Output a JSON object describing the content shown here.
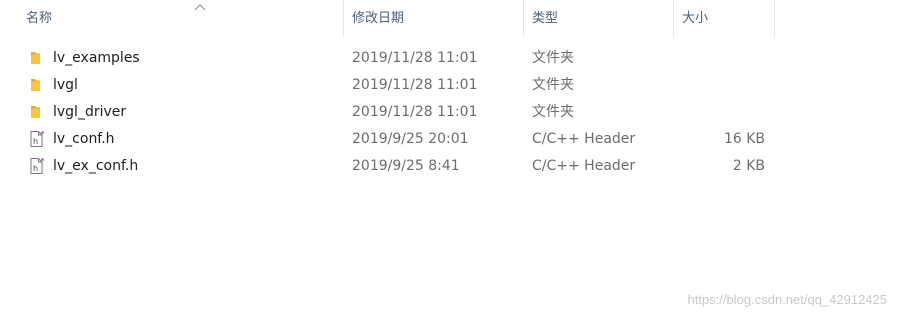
{
  "columns": {
    "name": "名称",
    "date": "修改日期",
    "type": "类型",
    "size": "大小"
  },
  "files": [
    {
      "name": "lv_examples",
      "date": "2019/11/28 11:01",
      "type": "文件夹",
      "size": "",
      "icon": "folder-icon"
    },
    {
      "name": "lvgl",
      "date": "2019/11/28 11:01",
      "type": "文件夹",
      "size": "",
      "icon": "folder-icon"
    },
    {
      "name": "lvgl_driver",
      "date": "2019/11/28 11:01",
      "type": "文件夹",
      "size": "",
      "icon": "folder-icon"
    },
    {
      "name": "lv_conf.h",
      "date": "2019/9/25 20:01",
      "type": "C/C++ Header",
      "size": "16 KB",
      "icon": "header-file-icon"
    },
    {
      "name": "lv_ex_conf.h",
      "date": "2019/9/25 8:41",
      "type": "C/C++ Header",
      "size": "2 KB",
      "icon": "header-file-icon"
    }
  ],
  "watermark": "https://blog.csdn.net/qq_42912425",
  "colors": {
    "folder": "#f8c541",
    "header_text": "#4c607a",
    "meta_text": "#6d6d6d"
  }
}
